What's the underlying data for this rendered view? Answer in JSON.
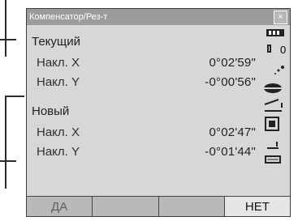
{
  "window": {
    "title": "Компенсатор/Рез-т",
    "close_label": "×"
  },
  "current": {
    "title": "Текущий",
    "rows": [
      {
        "label": "Накл. X",
        "value": "0°02'59\""
      },
      {
        "label": "Накл. Y",
        "value": "-0°00'56\""
      }
    ]
  },
  "new": {
    "title": "Новый",
    "rows": [
      {
        "label": "Накл. X",
        "value": "0°02'47\""
      },
      {
        "label": "Накл. Y",
        "value": "-0°01'44\""
      }
    ]
  },
  "side_indicator_text": "0",
  "softkeys": [
    "ДА",
    "",
    "",
    "НЕТ"
  ]
}
